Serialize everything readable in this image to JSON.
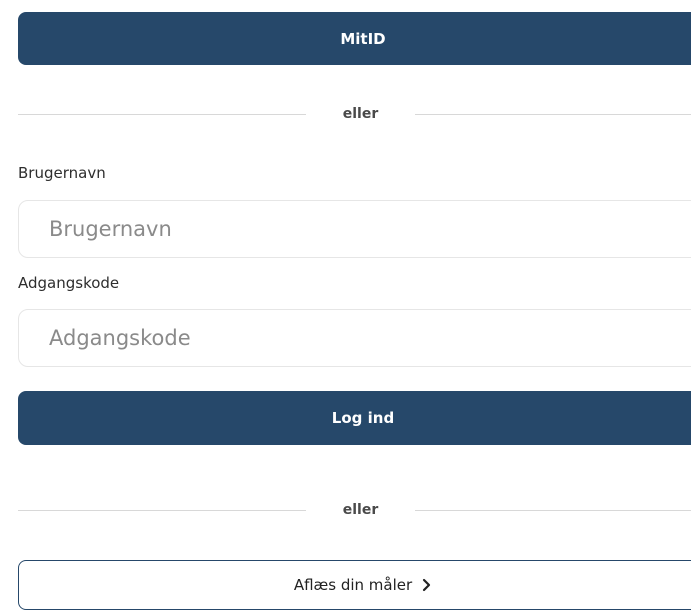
{
  "login": {
    "mitid_button_label": "MitID",
    "divider_text_1": "eller",
    "username": {
      "label": "Brugernavn",
      "placeholder": "Brugernavn",
      "value": ""
    },
    "password": {
      "label": "Adgangskode",
      "placeholder": "Adgangskode",
      "value": ""
    },
    "login_button_label": "Log ind",
    "divider_text_2": "eller",
    "meter_button_label": "Aflæs din måler",
    "meter_button_icon": "chevron-right-icon"
  },
  "colors": {
    "primary": "#26486a",
    "divider": "#d8d8d8",
    "input_border": "#e6e6e6"
  }
}
